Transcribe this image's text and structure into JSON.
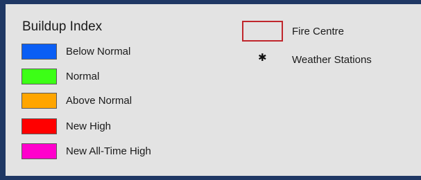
{
  "legend": {
    "title": "Buildup Index",
    "items": [
      {
        "label": "Below Normal",
        "color": "#0a5ef4"
      },
      {
        "label": "Normal",
        "color": "#3cff16"
      },
      {
        "label": "Above Normal",
        "color": "#ffa500"
      },
      {
        "label": "New High",
        "color": "#ff0000"
      },
      {
        "label": "New All-Time High",
        "color": "#ff00cc"
      }
    ],
    "fire_centre": {
      "label": "Fire Centre",
      "color": "#c0262c"
    },
    "weather_stations": {
      "label": "Weather Stations",
      "icon": "asterisk-icon",
      "glyph": "✱"
    }
  }
}
